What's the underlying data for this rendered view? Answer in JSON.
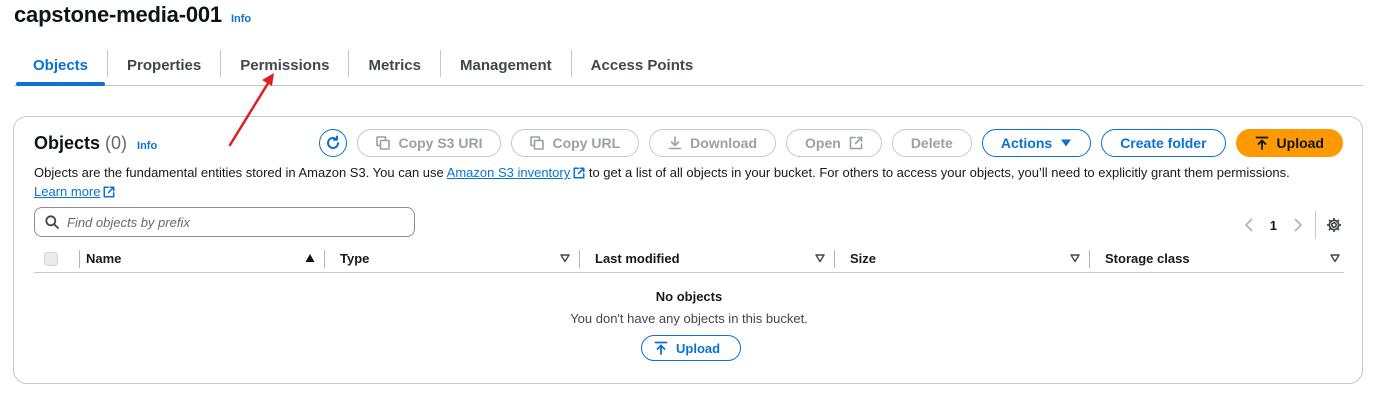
{
  "bucket": {
    "title": "capstone-media-001",
    "info_label": "Info"
  },
  "tabs": [
    {
      "label": "Objects",
      "active": true
    },
    {
      "label": "Properties",
      "active": false
    },
    {
      "label": "Permissions",
      "active": false
    },
    {
      "label": "Metrics",
      "active": false
    },
    {
      "label": "Management",
      "active": false
    },
    {
      "label": "Access Points",
      "active": false
    }
  ],
  "objects_panel": {
    "title": "Objects",
    "count": "(0)",
    "info_label": "Info",
    "toolbar": {
      "refresh_icon": "refresh-icon",
      "copy_s3_uri": "Copy S3 URI",
      "copy_url": "Copy URL",
      "download": "Download",
      "open": "Open",
      "delete": "Delete",
      "actions": "Actions",
      "create_folder": "Create folder",
      "upload": "Upload"
    },
    "description": {
      "part1": "Objects are the fundamental entities stored in Amazon S3. You can use ",
      "inventory_link": "Amazon S3 inventory",
      "part2": " to get a list of all objects in your bucket. For others to access your objects, you’ll need to explicitly grant them permissions.",
      "learn_more": "Learn more"
    },
    "search": {
      "placeholder": "Find objects by prefix",
      "value": ""
    },
    "pagination": {
      "current_page": "1"
    },
    "table": {
      "columns": [
        {
          "label": "Name",
          "sort": "ascending"
        },
        {
          "label": "Type",
          "sort": "none"
        },
        {
          "label": "Last modified",
          "sort": "none"
        },
        {
          "label": "Size",
          "sort": "none"
        },
        {
          "label": "Storage class",
          "sort": "none"
        }
      ],
      "rows": []
    },
    "empty_state": {
      "title": "No objects",
      "message": "You don't have any objects in this bucket.",
      "upload_label": "Upload"
    }
  },
  "colors": {
    "accent_blue": "#0972d3",
    "primary_orange": "#ff9900",
    "annotation_red": "#e02020"
  }
}
